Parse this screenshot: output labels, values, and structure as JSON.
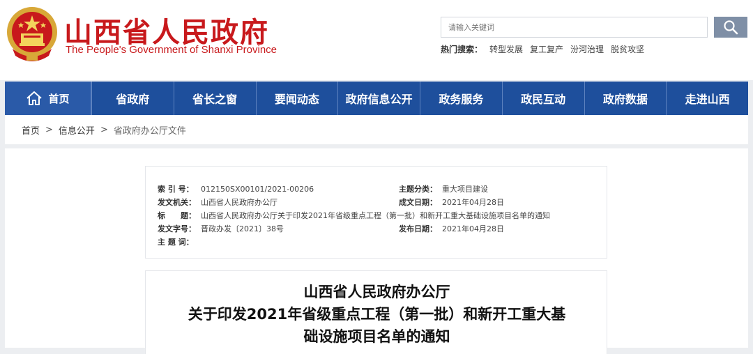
{
  "header": {
    "title_cn": "山西省人民政府",
    "title_en": "The People's Government of Shanxi Province",
    "search_placeholder": "请输入关键词",
    "hot_label": "热门搜索：",
    "hot_items": [
      "转型发展",
      "复工复产",
      "汾河治理",
      "脱贫攻坚"
    ],
    "brand_color": "#c8191c"
  },
  "nav": {
    "home": "首页",
    "items": [
      "省政府",
      "省长之窗",
      "要闻动态",
      "政府信息公开",
      "政务服务",
      "政民互动",
      "政府数据",
      "走进山西"
    ],
    "color": "#1e4f9c"
  },
  "breadcrumb": {
    "items": [
      "首页",
      "信息公开",
      "省政府办公厅文件"
    ],
    "separator": ">"
  },
  "meta": {
    "index_label": "索 引 号：",
    "index_value": "012150SX00101/2021-00206",
    "category_label": "主题分类：",
    "category_value": "重大项目建设",
    "issuer_label": "发文机关：",
    "issuer_value": "山西省人民政府办公厅",
    "created_label": "成文日期：",
    "created_value": "2021年04月28日",
    "title_label": "标　　题：",
    "title_value": "山西省人民政府办公厅关于印发2021年省级重点工程（第一批）和新开工重大基础设施项目名单的通知",
    "docno_label": "发文字号：",
    "docno_value": "晋政办发〔2021〕38号",
    "published_label": "发布日期：",
    "published_value": "2021年04月28日",
    "keywords_label": "主 题 词：",
    "keywords_value": ""
  },
  "document": {
    "title_line1": "山西省人民政府办公厅",
    "title_line2": "关于印发2021年省级重点工程（第一批）和新开工重大基",
    "title_line3": "础设施项目名单的通知"
  }
}
